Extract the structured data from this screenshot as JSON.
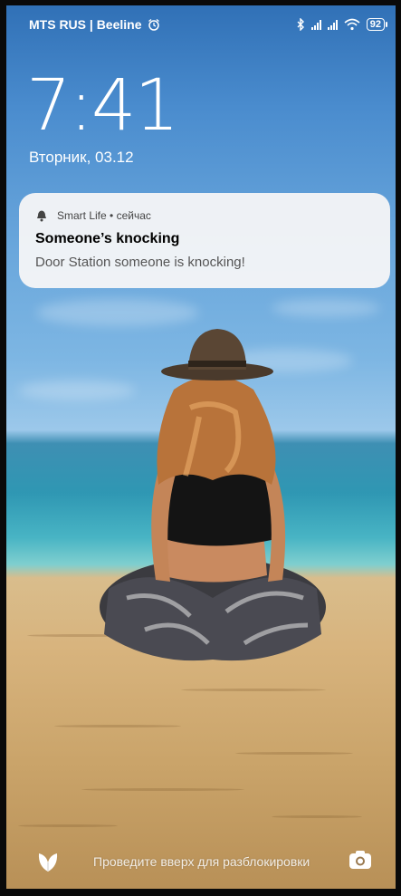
{
  "status_bar": {
    "carrier": "MTS RUS | Beeline",
    "battery_level": "92",
    "icons": [
      "alarm-icon",
      "bluetooth-icon",
      "signal-icon",
      "signal-icon",
      "wifi-icon",
      "battery-icon"
    ]
  },
  "lock_screen": {
    "time": "7:41",
    "date": "Вторник, 03.12"
  },
  "notification": {
    "app_name": "Smart Life",
    "time_label": "сейчас",
    "title": "Someone’s knocking",
    "body": "Door Station someone is knocking!",
    "icon": "bell-icon"
  },
  "bottom_bar": {
    "hint": "Проведите вверх для разблокировки",
    "left_icon": "leaf-icon",
    "right_icon": "camera-icon"
  },
  "colors": {
    "sky_top": "#2f6fb5",
    "sea": "#2f97b3",
    "sand": "#d8b47e",
    "notification_bg": "#f5f5f7"
  }
}
